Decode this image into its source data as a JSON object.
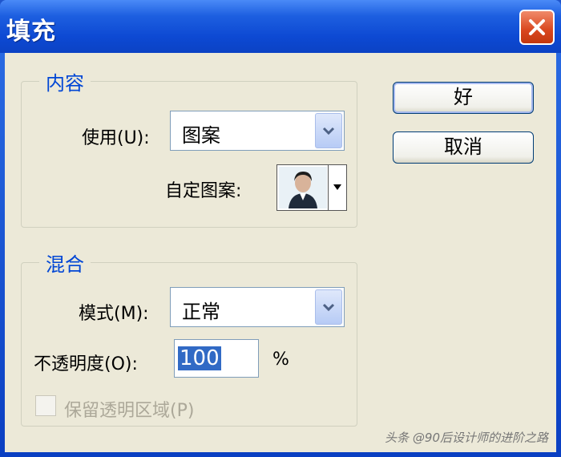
{
  "window": {
    "title": "填充",
    "close_icon": "close-icon"
  },
  "content_group": {
    "legend": "内容",
    "use_label": "使用(U):",
    "use_value": "图案",
    "custom_pattern_label": "自定图案:"
  },
  "blend_group": {
    "legend": "混合",
    "mode_label": "模式(M):",
    "mode_value": "正常",
    "opacity_label": "不透明度(O):",
    "opacity_value": "100",
    "opacity_unit": "%",
    "preserve_label": "保留透明区域(P)",
    "preserve_checked": false,
    "preserve_disabled": true
  },
  "buttons": {
    "ok": "好",
    "cancel": "取消"
  },
  "watermark": "头条 @90后设计师的进阶之路",
  "colors": {
    "title_bar": "#0b47d0",
    "dialog_bg": "#ece9d8",
    "legend_text": "#0046d5",
    "close_button": "#d9461e",
    "selection": "#316ac5"
  }
}
